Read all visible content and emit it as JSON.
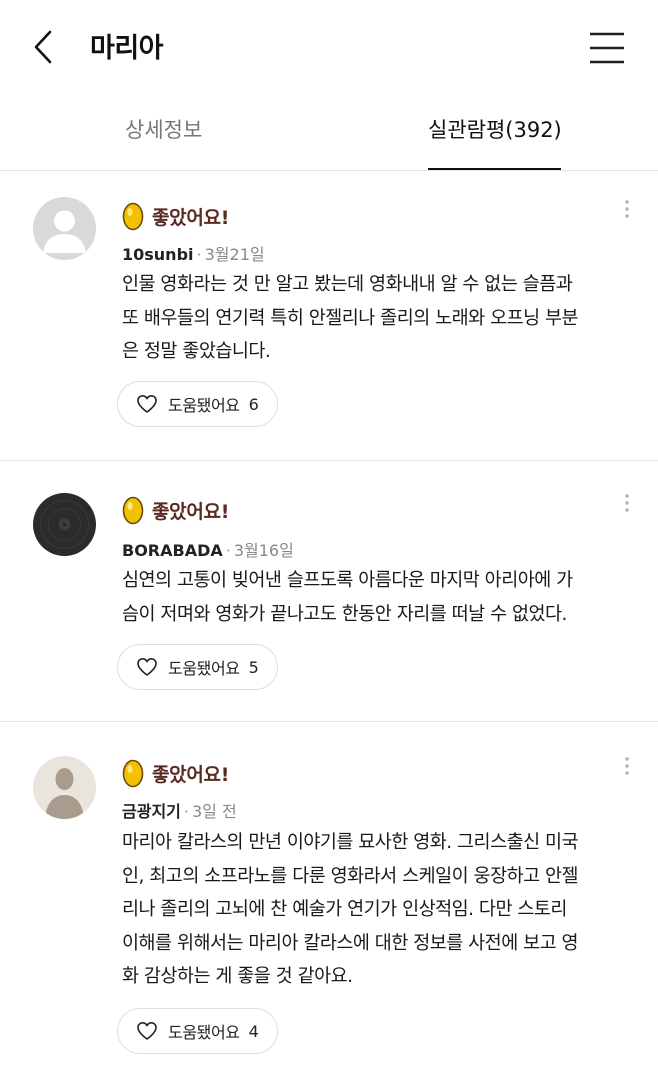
{
  "header": {
    "title": "마리아"
  },
  "tabs": [
    {
      "label": "상세정보",
      "active": false
    },
    {
      "label": "실관람평(392)",
      "active": true
    }
  ],
  "colors": {
    "rating_label": "#5a2a22",
    "egg_fill": "#f2c200",
    "egg_outline": "#6b4a10",
    "active_tab": "#111111",
    "inactive_tab": "#777777"
  },
  "reviews": [
    {
      "avatar_icon": "default-profile-icon",
      "rating_icon": "golden-egg-icon",
      "rating_label": "좋았어요!",
      "author": "10sunbi",
      "date": "3월21일",
      "text_lines": [
        "인물 영화라는 것 만 알고 봤는데 영화내내 알 수 없는 슬픔과",
        "또 배우들의 연기력 특히 안젤리나 졸리의 노래와 오프닝 부분",
        "은 정말 좋았습니다."
      ],
      "helpful_label": "도움됐어요",
      "helpful_count": "6"
    },
    {
      "avatar_icon": "dark-vinyl-avatar",
      "rating_icon": "golden-egg-icon",
      "rating_label": "좋았어요!",
      "author": "BORABADA",
      "date": "3월16일",
      "text_lines": [
        "심연의 고통이 빚어낸 슬프도록 아름다운 마지막 아리아에 가",
        "슴이 저며와 영화가 끝나고도 한동안 자리를 떠날 수 없었다."
      ],
      "helpful_label": "도움됐어요",
      "helpful_count": "5"
    },
    {
      "avatar_icon": "silhouette-avatar",
      "rating_icon": "golden-egg-icon",
      "rating_label": "좋았어요!",
      "author": "금광지기",
      "date": "3일 전",
      "text_lines": [
        "마리아 칼라스의 만년 이야기를 묘사한 영화. 그리스출신 미국",
        "인, 최고의 소프라노를 다룬 영화라서 스케일이 웅장하고 안젤",
        "리나 졸리의 고뇌에 찬 예술가 연기가 인상적임. 다만 스토리",
        "이해를 위해서는 마리아 칼라스에 대한 정보를 사전에 보고 영",
        "화 감상하는 게 좋을 것 같아요."
      ],
      "helpful_label": "도움됐어요",
      "helpful_count": "4"
    }
  ]
}
